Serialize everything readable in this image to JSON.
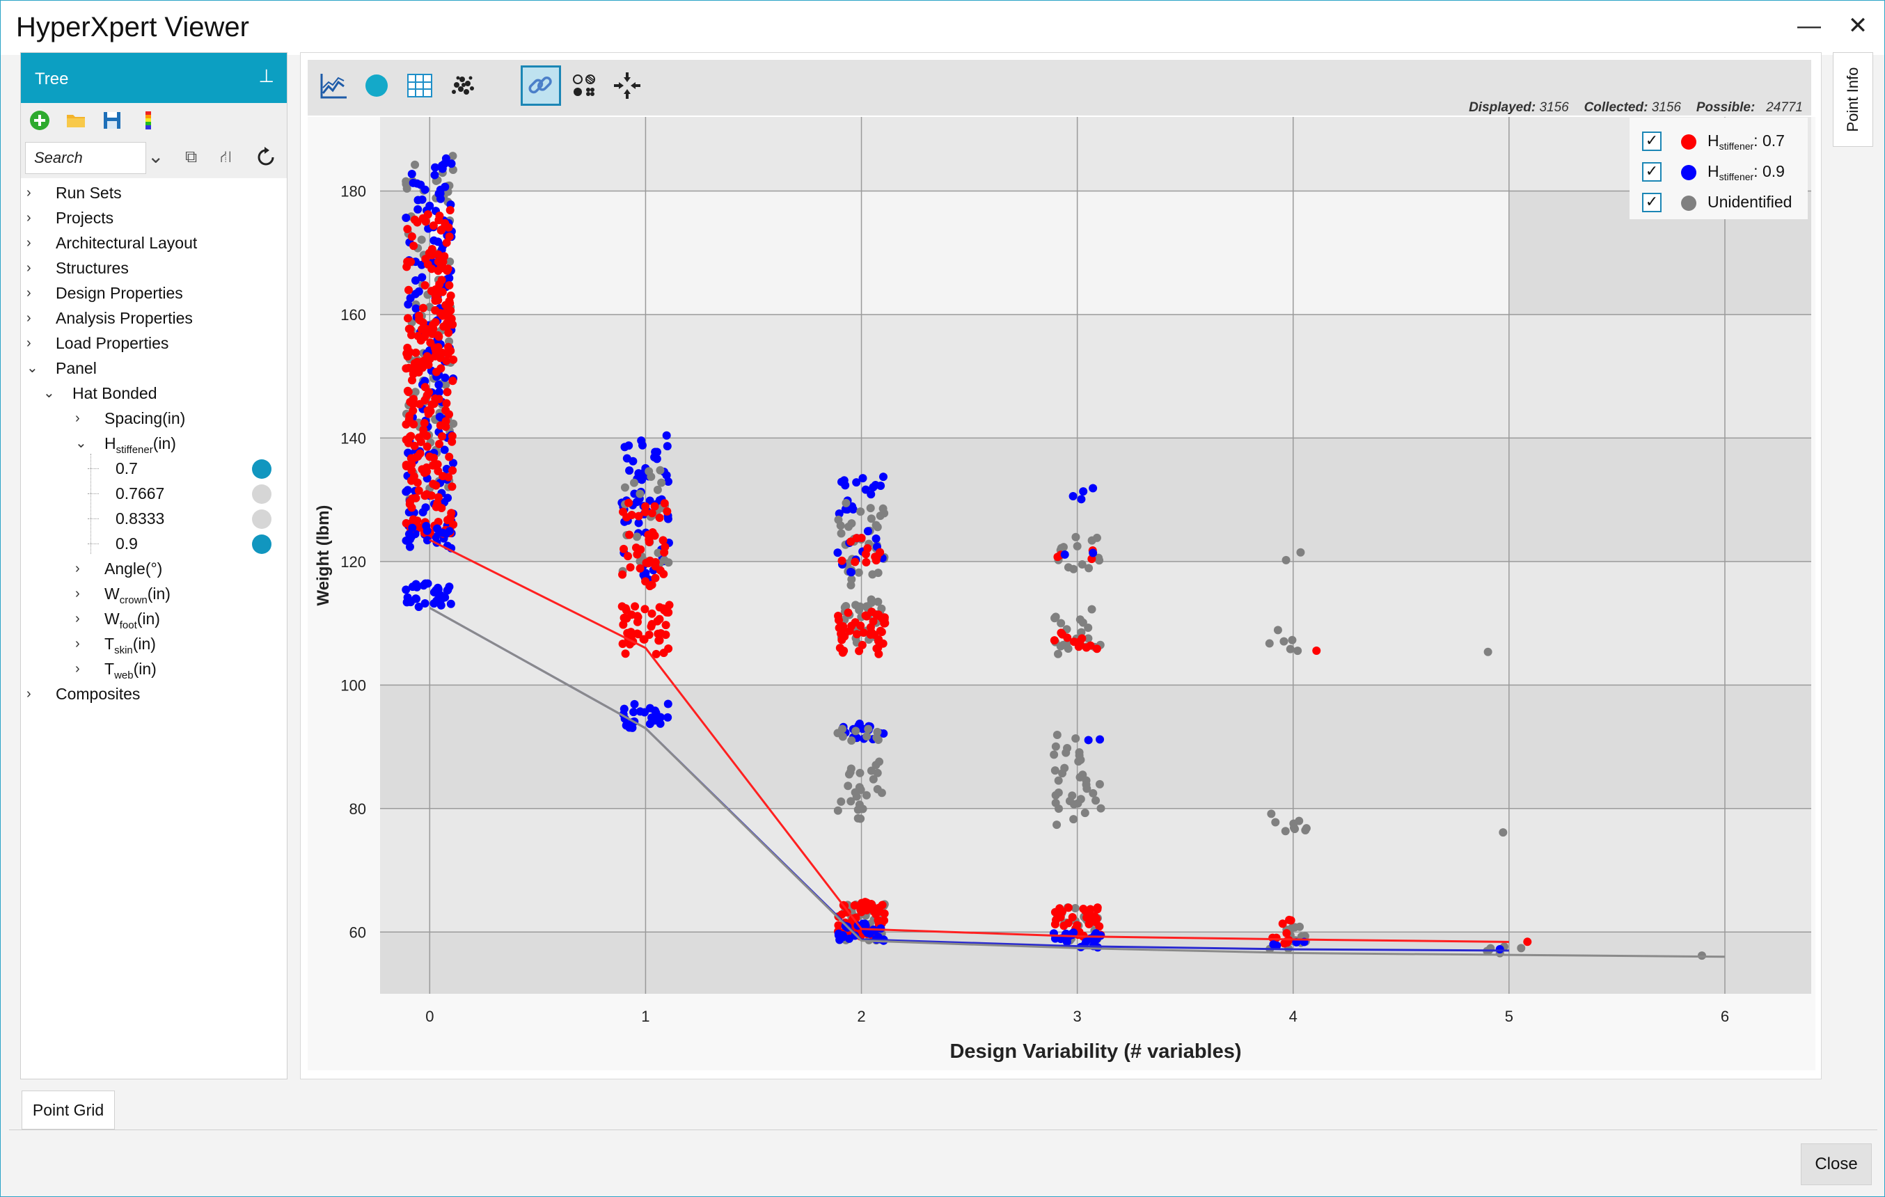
{
  "window": {
    "title": "HyperXpert Viewer",
    "minimize_glyph": "—",
    "close_glyph": "✕"
  },
  "tree_panel": {
    "header": "Tree",
    "search_placeholder": "Search",
    "toolbar_icons": [
      "add-icon",
      "folder-icon",
      "save-icon",
      "color-scale-icon"
    ],
    "nodes": [
      {
        "label": "Run Sets",
        "level": 0,
        "state": "collapsed"
      },
      {
        "label": "Projects",
        "level": 0,
        "state": "collapsed"
      },
      {
        "label": "Architectural Layout",
        "level": 0,
        "state": "collapsed"
      },
      {
        "label": "Structures",
        "level": 0,
        "state": "collapsed"
      },
      {
        "label": "Design Properties",
        "level": 0,
        "state": "collapsed"
      },
      {
        "label": "Analysis Properties",
        "level": 0,
        "state": "collapsed"
      },
      {
        "label": "Load Properties",
        "level": 0,
        "state": "collapsed"
      },
      {
        "label": "Panel",
        "level": 0,
        "state": "expanded"
      },
      {
        "label": "Hat Bonded",
        "level": 1,
        "state": "expanded"
      },
      {
        "label": "Spacing(in)",
        "level": 2,
        "state": "collapsed"
      },
      {
        "label": "H",
        "sub": "stiffener",
        "suffix": "(in)",
        "level": 2,
        "state": "expanded"
      },
      {
        "label": "0.7",
        "level": 3,
        "state": "leaf",
        "selected": true
      },
      {
        "label": "0.7667",
        "level": 3,
        "state": "leaf",
        "selected": false
      },
      {
        "label": "0.8333",
        "level": 3,
        "state": "leaf",
        "selected": false
      },
      {
        "label": "0.9",
        "level": 3,
        "state": "leaf",
        "selected": true
      },
      {
        "label": "Angle(°)",
        "level": 2,
        "state": "collapsed"
      },
      {
        "label": "W",
        "sub": "crown",
        "suffix": "(in)",
        "level": 2,
        "state": "collapsed"
      },
      {
        "label": "W",
        "sub": "foot",
        "suffix": "(in)",
        "level": 2,
        "state": "collapsed"
      },
      {
        "label": "T",
        "sub": "skin",
        "suffix": "(in)",
        "level": 2,
        "state": "collapsed"
      },
      {
        "label": "T",
        "sub": "web",
        "suffix": "(in)",
        "level": 2,
        "state": "collapsed"
      },
      {
        "label": "Composites",
        "level": 0,
        "state": "collapsed"
      }
    ],
    "selected_color": "#1196bf",
    "unselected_color": "#d6d6d6"
  },
  "chart_toolbar": {
    "buttons": [
      "line-chart-icon",
      "circle-icon",
      "table-icon",
      "scatter-cloud-icon",
      "link-icon",
      "point-styles-icon",
      "collapse-arrows-icon"
    ],
    "active": "link-icon",
    "stats": {
      "displayed_label": "Displayed:",
      "displayed": "3156",
      "collected_label": "Collected:",
      "collected": "3156",
      "possible_label": "Possible:",
      "possible": "24771"
    }
  },
  "legend": [
    {
      "label": "H",
      "sub": "stiffener",
      "suffix": ": 0.7",
      "color": "#ff0000",
      "checked": true,
      "check_glyph": "✓"
    },
    {
      "label": "H",
      "sub": "stiffener",
      "suffix": ": 0.9",
      "color": "#0000ff",
      "checked": true,
      "check_glyph": "✓"
    },
    {
      "label": "Unidentified",
      "sub": "",
      "suffix": "",
      "color": "#808080",
      "checked": true,
      "check_glyph": "✓"
    }
  ],
  "chart_data": {
    "type": "scatter",
    "title": "",
    "xlabel": "Design Variability (# variables)",
    "ylabel": "Weight (lbm)",
    "x_ticks": [
      0,
      1,
      2,
      3,
      4,
      5,
      6
    ],
    "y_ticks": [
      60,
      80,
      100,
      120,
      140,
      160,
      180
    ],
    "xlim": [
      -0.23,
      6.4
    ],
    "ylim": [
      50,
      192
    ],
    "grid": true,
    "legend_position": "top-right",
    "pareto_lines": [
      {
        "name": "H stiffener: 0.7",
        "color": "#ff2020",
        "points": [
          [
            0,
            123.5
          ],
          [
            1,
            106
          ],
          [
            2,
            60.5
          ],
          [
            3,
            59.3
          ],
          [
            4,
            58.8
          ],
          [
            5,
            58.4
          ]
        ]
      },
      {
        "name": "H stiffener: 0.9",
        "color": "#2a2ad0",
        "points": [
          [
            0,
            112.5
          ],
          [
            1,
            93
          ],
          [
            2,
            58.8
          ],
          [
            3,
            57.7
          ],
          [
            4,
            57.2
          ],
          [
            5,
            57.0
          ]
        ]
      },
      {
        "name": "Unidentified",
        "color": "#8a8a8a",
        "points": [
          [
            0,
            112.5
          ],
          [
            1,
            93
          ],
          [
            2,
            58.6
          ],
          [
            3,
            57.4
          ],
          [
            4,
            56.6
          ],
          [
            5,
            56.3
          ],
          [
            6,
            56.0
          ]
        ]
      }
    ],
    "point_clusters": [
      {
        "x": 0,
        "ymin": 130,
        "ymax": 186,
        "color": "#808080",
        "n": 90
      },
      {
        "x": 0,
        "ymin": 123,
        "ymax": 186,
        "color": "#0000ff",
        "n": 150
      },
      {
        "x": 0,
        "ymin": 124,
        "ymax": 177,
        "color": "#ff0000",
        "n": 240
      },
      {
        "x": 0,
        "ymin": 122,
        "ymax": 126,
        "color": "#0000ff",
        "n": 15
      },
      {
        "x": 0,
        "ymin": 112.5,
        "ymax": 116.5,
        "color": "#0000ff",
        "n": 30
      },
      {
        "x": 1,
        "ymin": 117,
        "ymax": 141,
        "color": "#0000ff",
        "n": 60
      },
      {
        "x": 1,
        "ymin": 116,
        "ymax": 135,
        "color": "#808080",
        "n": 25
      },
      {
        "x": 1,
        "ymin": 116,
        "ymax": 130,
        "color": "#ff0000",
        "n": 40
      },
      {
        "x": 1,
        "ymin": 105,
        "ymax": 113,
        "color": "#ff0000",
        "n": 45
      },
      {
        "x": 1,
        "ymin": 93,
        "ymax": 97,
        "color": "#0000ff",
        "n": 25
      },
      {
        "x": 2,
        "ymin": 127,
        "ymax": 134,
        "color": "#0000ff",
        "n": 18
      },
      {
        "x": 2,
        "ymin": 116,
        "ymax": 130,
        "color": "#808080",
        "n": 35
      },
      {
        "x": 2,
        "ymin": 118,
        "ymax": 125,
        "color": "#0000ff",
        "n": 12
      },
      {
        "x": 2,
        "ymin": 119,
        "ymax": 124,
        "color": "#ff0000",
        "n": 12
      },
      {
        "x": 2,
        "ymin": 106,
        "ymax": 114,
        "color": "#808080",
        "n": 30
      },
      {
        "x": 2,
        "ymin": 105,
        "ymax": 112,
        "color": "#ff0000",
        "n": 45
      },
      {
        "x": 2,
        "ymin": 91,
        "ymax": 94,
        "color": "#0000ff",
        "n": 15
      },
      {
        "x": 2,
        "ymin": 91,
        "ymax": 93,
        "color": "#808080",
        "n": 10
      },
      {
        "x": 2,
        "ymin": 78,
        "ymax": 88,
        "color": "#808080",
        "n": 25
      },
      {
        "x": 2,
        "ymin": 58.5,
        "ymax": 65,
        "color": "#808080",
        "n": 30
      },
      {
        "x": 2,
        "ymin": 59,
        "ymax": 65,
        "color": "#ff0000",
        "n": 60
      },
      {
        "x": 2,
        "ymin": 58.5,
        "ymax": 61.5,
        "color": "#0000ff",
        "n": 30
      },
      {
        "x": 3,
        "ymin": 130,
        "ymax": 132,
        "color": "#0000ff",
        "n": 4
      },
      {
        "x": 3,
        "ymin": 118,
        "ymax": 124,
        "color": "#808080",
        "n": 14
      },
      {
        "x": 3,
        "ymin": 119,
        "ymax": 122,
        "color": "#ff0000",
        "n": 4
      },
      {
        "x": 3,
        "ymin": 121,
        "ymax": 122,
        "color": "#0000ff",
        "n": 2
      },
      {
        "x": 3,
        "ymin": 105,
        "ymax": 113,
        "color": "#808080",
        "n": 20
      },
      {
        "x": 3,
        "ymin": 105,
        "ymax": 109,
        "color": "#ff0000",
        "n": 12
      },
      {
        "x": 3,
        "ymin": 91,
        "ymax": 91.5,
        "color": "#0000ff",
        "n": 2
      },
      {
        "x": 3,
        "ymin": 77,
        "ymax": 92,
        "color": "#808080",
        "n": 35
      },
      {
        "x": 3,
        "ymin": 57.5,
        "ymax": 64,
        "color": "#808080",
        "n": 25
      },
      {
        "x": 3,
        "ymin": 59,
        "ymax": 64,
        "color": "#ff0000",
        "n": 35
      },
      {
        "x": 3,
        "ymin": 57.5,
        "ymax": 60,
        "color": "#0000ff",
        "n": 25
      },
      {
        "x": 4,
        "ymin": 119,
        "ymax": 122,
        "color": "#808080",
        "n": 2
      },
      {
        "x": 4,
        "ymin": 105,
        "ymax": 111,
        "color": "#808080",
        "n": 6
      },
      {
        "x": 4,
        "ymin": 105,
        "ymax": 106,
        "color": "#ff0000",
        "n": 1
      },
      {
        "x": 4,
        "ymin": 76,
        "ymax": 79.5,
        "color": "#808080",
        "n": 9
      },
      {
        "x": 4,
        "ymin": 57,
        "ymax": 61,
        "color": "#808080",
        "n": 14
      },
      {
        "x": 4,
        "ymin": 58,
        "ymax": 62,
        "color": "#ff0000",
        "n": 10
      },
      {
        "x": 4,
        "ymin": 57.5,
        "ymax": 58.5,
        "color": "#0000ff",
        "n": 4
      },
      {
        "x": 5,
        "ymin": 105,
        "ymax": 105.5,
        "color": "#808080",
        "n": 1
      },
      {
        "x": 5,
        "ymin": 76,
        "ymax": 76.5,
        "color": "#808080",
        "n": 1
      },
      {
        "x": 5,
        "ymin": 56.5,
        "ymax": 58,
        "color": "#808080",
        "n": 6
      },
      {
        "x": 5,
        "ymin": 58,
        "ymax": 58.8,
        "color": "#ff0000",
        "n": 1
      },
      {
        "x": 5,
        "ymin": 57,
        "ymax": 57.5,
        "color": "#0000ff",
        "n": 1
      },
      {
        "x": 6,
        "ymin": 56,
        "ymax": 56.2,
        "color": "#808080",
        "n": 1
      }
    ]
  },
  "side_tabs": {
    "point_info": "Point Info",
    "point_grid": "Point Grid"
  },
  "footer": {
    "close_label": "Close"
  }
}
